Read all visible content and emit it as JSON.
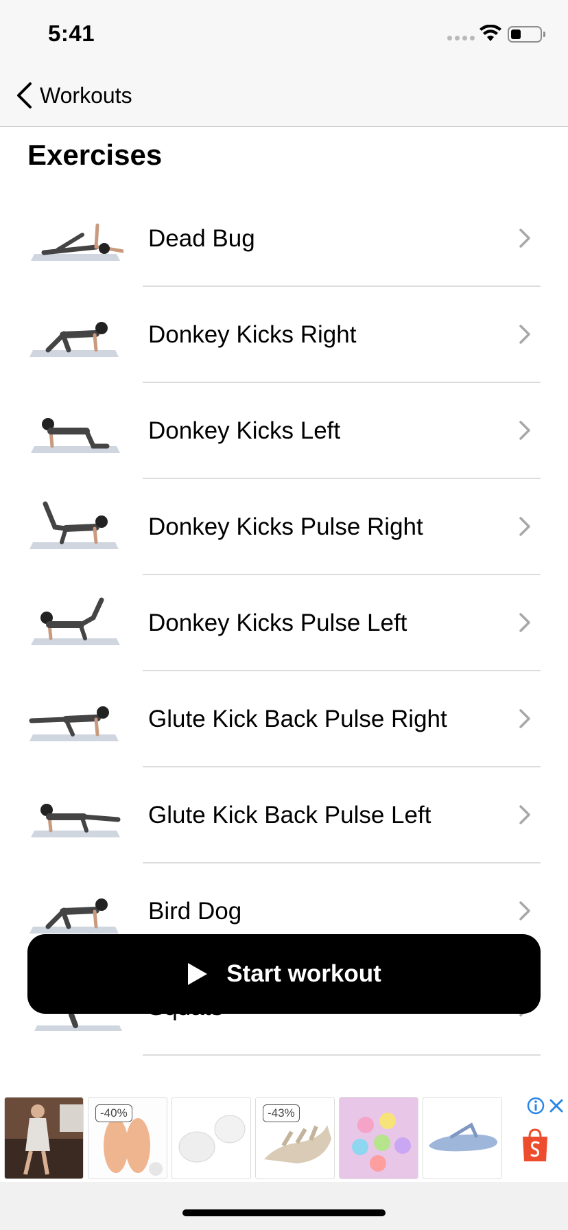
{
  "status_bar": {
    "time": "5:41"
  },
  "nav": {
    "back_label": "Workouts"
  },
  "section_title": "Exercises",
  "exercises": [
    {
      "name": "Dead Bug"
    },
    {
      "name": "Donkey Kicks Right"
    },
    {
      "name": "Donkey Kicks Left"
    },
    {
      "name": "Donkey Kicks Pulse Right"
    },
    {
      "name": "Donkey Kicks Pulse Left"
    },
    {
      "name": "Glute Kick Back Pulse Right"
    },
    {
      "name": "Glute Kick Back Pulse Left"
    },
    {
      "name": "Bird Dog"
    },
    {
      "name": "Squats"
    }
  ],
  "start_button": {
    "label": "Start workout",
    "icon": "play-icon"
  },
  "ad": {
    "items": [
      {
        "icon": "dress-photo",
        "discount": ""
      },
      {
        "icon": "foot-insole-photo",
        "discount": "-40%"
      },
      {
        "icon": "gel-pad-photo",
        "discount": ""
      },
      {
        "icon": "sandal-photo",
        "discount": "-43%"
      },
      {
        "icon": "charms-photo",
        "discount": ""
      },
      {
        "icon": "flip-flop-photo",
        "discount": ""
      }
    ],
    "accent": "#ee4d2d"
  }
}
